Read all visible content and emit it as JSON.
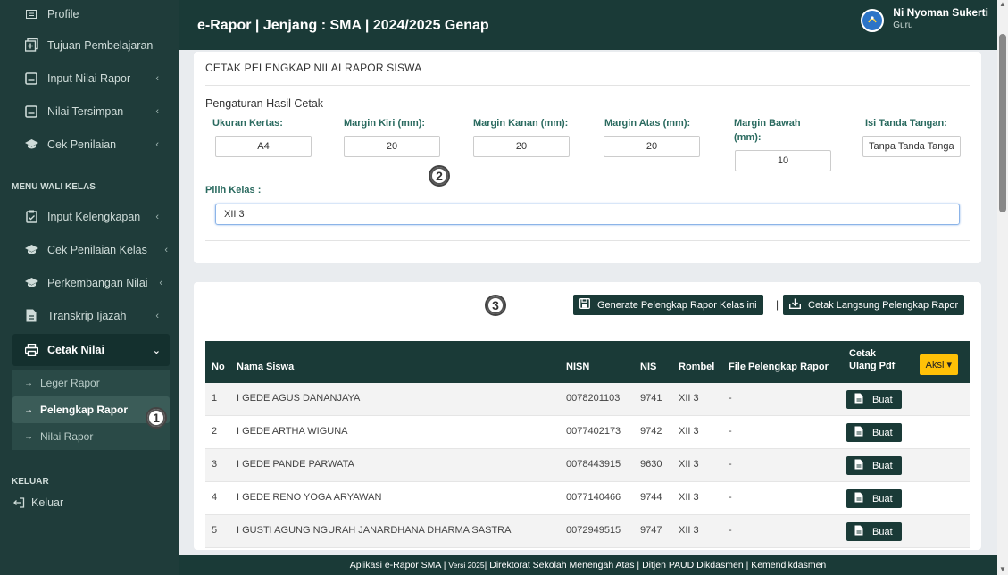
{
  "header": {
    "title": "e-Rapor | Jenjang : SMA | 2024/2025 Genap",
    "user_name": "Ni Nyoman Sukerti",
    "user_role": "Guru"
  },
  "sidebar": {
    "items_top": [
      {
        "label": "Profile",
        "icon": "id-card-icon"
      },
      {
        "label": "Tujuan Pembelajaran",
        "icon": "plus-square-icon"
      },
      {
        "label": "Input Nilai Rapor",
        "icon": "square-icon"
      },
      {
        "label": "Nilai Tersimpan",
        "icon": "square-icon"
      },
      {
        "label": "Cek Penilaian",
        "icon": "graduation-cap-icon"
      }
    ],
    "section_wali": "MENU WALI KELAS",
    "items_wali": [
      {
        "label": "Input Kelengkapan",
        "icon": "checklist-icon"
      },
      {
        "label": "Cek Penilaian Kelas",
        "icon": "graduation-cap-icon"
      },
      {
        "label": "Perkembangan Nilai",
        "icon": "graduation-cap-icon"
      },
      {
        "label": "Transkrip Ijazah",
        "icon": "file-icon"
      }
    ],
    "cetak_label": "Cetak Nilai",
    "sub_items": [
      "Leger Rapor",
      "Pelengkap Rapor",
      "Nilai Rapor"
    ],
    "section_keluar": "KELUAR",
    "logout_label": "Keluar"
  },
  "badges": [
    "1",
    "2",
    "3"
  ],
  "card1": {
    "title": "CETAK PELENGKAP NILAI RAPOR SISWA",
    "settings_title": "Pengaturan Hasil Cetak",
    "fields": [
      {
        "label": "Ukuran Kertas:",
        "value": "A4"
      },
      {
        "label": "Margin Kiri (mm):",
        "value": "20"
      },
      {
        "label": "Margin Kanan (mm):",
        "value": "20"
      },
      {
        "label": "Margin Atas (mm):",
        "value": "20"
      },
      {
        "label": "Margin Bawah (mm):",
        "value": "10"
      },
      {
        "label": "Isi Tanda Tangan:",
        "value": "Tanpa Tanda Tanga"
      }
    ],
    "kelas_label": "Pilih Kelas :",
    "kelas_value": "XII 3"
  },
  "card2": {
    "generate_label": "Generate Pelengkap Rapor Kelas ini",
    "separator": "|",
    "cetak_label": "Cetak Langsung Pelengkap Rapor",
    "columns": [
      "No",
      "Nama Siswa",
      "NISN",
      "NIS",
      "Rombel",
      "File Pelengkap Rapor",
      "Cetak Ulang Pdf"
    ],
    "aksi_label": "Aksi ▾",
    "buat_label": "Buat",
    "rows": [
      {
        "no": "1",
        "nama": "I GEDE AGUS DANANJAYA",
        "nisn": "0078201103",
        "nis": "9741",
        "rombel": "XII 3",
        "file": "-"
      },
      {
        "no": "2",
        "nama": "I GEDE ARTHA WIGUNA",
        "nisn": "0077402173",
        "nis": "9742",
        "rombel": "XII 3",
        "file": "-"
      },
      {
        "no": "3",
        "nama": "I GEDE PANDE PARWATA",
        "nisn": "0078443915",
        "nis": "9630",
        "rombel": "XII 3",
        "file": "-"
      },
      {
        "no": "4",
        "nama": "I GEDE RENO YOGA ARYAWAN",
        "nisn": "0077140466",
        "nis": "9744",
        "rombel": "XII 3",
        "file": "-"
      },
      {
        "no": "5",
        "nama": "I GUSTI AGUNG NGURAH JANARDHANA DHARMA SASTRA",
        "nisn": "0072949515",
        "nis": "9747",
        "rombel": "XII 3",
        "file": "-"
      }
    ]
  },
  "footer": {
    "prefix": "Aplikasi e-Rapor SMA | ",
    "version": "Versi 2025",
    "suffix": " | Direktorat Sekolah Menengah Atas | Ditjen PAUD Dikdasmen | Kemendikdasmen"
  }
}
